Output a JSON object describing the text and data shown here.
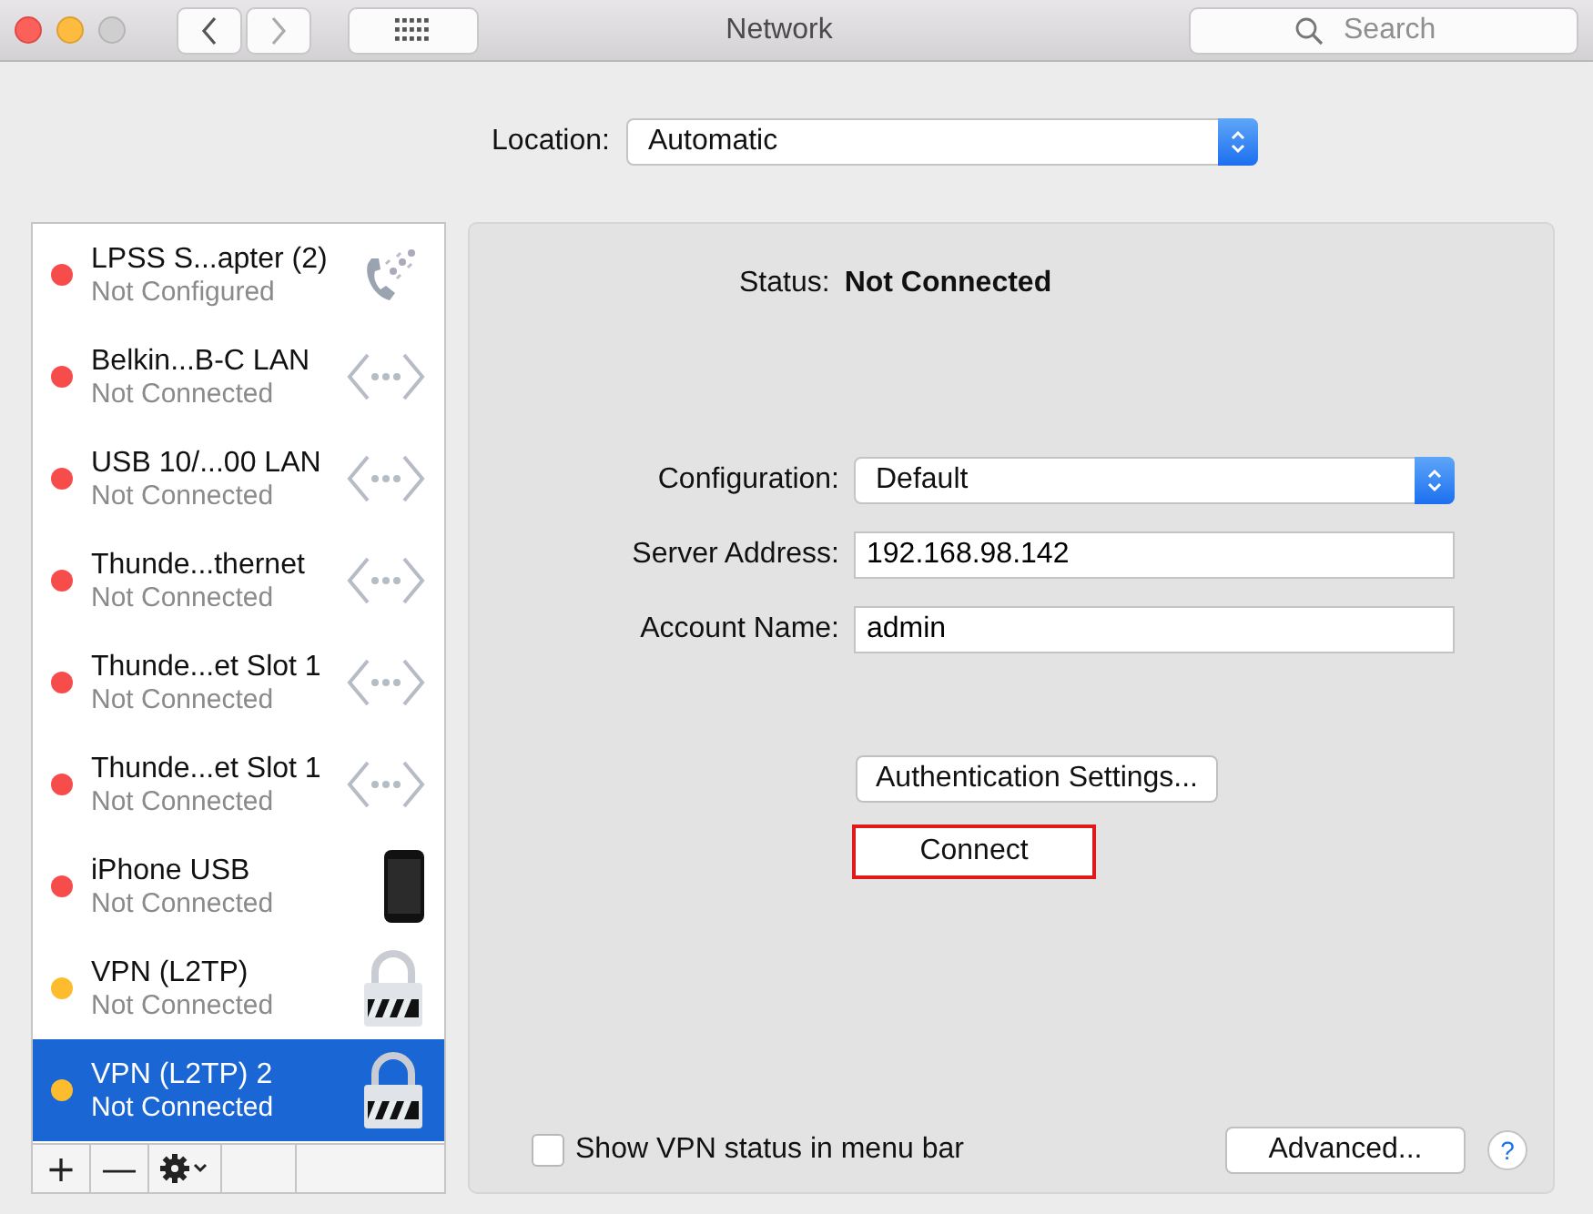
{
  "window": {
    "title": "Network"
  },
  "toolbar": {
    "search_placeholder": "Search"
  },
  "location": {
    "label": "Location:",
    "value": "Automatic"
  },
  "services": [
    {
      "name": "LPSS S...apter (2)",
      "status": "Not Configured",
      "color": "#f64c4c",
      "kind": "phone",
      "selected": false
    },
    {
      "name": "Belkin...B-C LAN",
      "status": "Not Connected",
      "color": "#f64c4c",
      "kind": "ethernet",
      "selected": false
    },
    {
      "name": "USB 10/...00 LAN",
      "status": "Not Connected",
      "color": "#f64c4c",
      "kind": "ethernet",
      "selected": false
    },
    {
      "name": "Thunde...thernet",
      "status": "Not Connected",
      "color": "#f64c4c",
      "kind": "ethernet",
      "selected": false
    },
    {
      "name": "Thunde...et Slot 1",
      "status": "Not Connected",
      "color": "#f64c4c",
      "kind": "ethernet",
      "selected": false
    },
    {
      "name": "Thunde...et Slot 1",
      "status": "Not Connected",
      "color": "#f64c4c",
      "kind": "ethernet",
      "selected": false
    },
    {
      "name": "iPhone USB",
      "status": "Not Connected",
      "color": "#f64c4c",
      "kind": "iphone",
      "selected": false
    },
    {
      "name": "VPN (L2TP)",
      "status": "Not Connected",
      "color": "#fdbc2e",
      "kind": "lock",
      "selected": false
    },
    {
      "name": "VPN (L2TP) 2",
      "status": "Not Connected",
      "color": "#fdbc2e",
      "kind": "lock",
      "selected": true
    }
  ],
  "list_buttons": [
    "+",
    "—"
  ],
  "detail": {
    "status_label": "Status:",
    "status_value": "Not Connected",
    "fields": [
      {
        "kind": "popup",
        "label": "Configuration:",
        "value": "Default"
      },
      {
        "kind": "text",
        "label": "Server Address:",
        "value": "192.168.98.142"
      },
      {
        "kind": "text",
        "label": "Account Name:",
        "value": "admin"
      }
    ],
    "auth_button": "Authentication Settings...",
    "connect_button": {
      "label": "Connect",
      "highlighted": true
    },
    "show_status": {
      "label": "Show VPN status in menu bar",
      "checked": false
    },
    "advanced_button": "Advanced...",
    "help": "?"
  }
}
